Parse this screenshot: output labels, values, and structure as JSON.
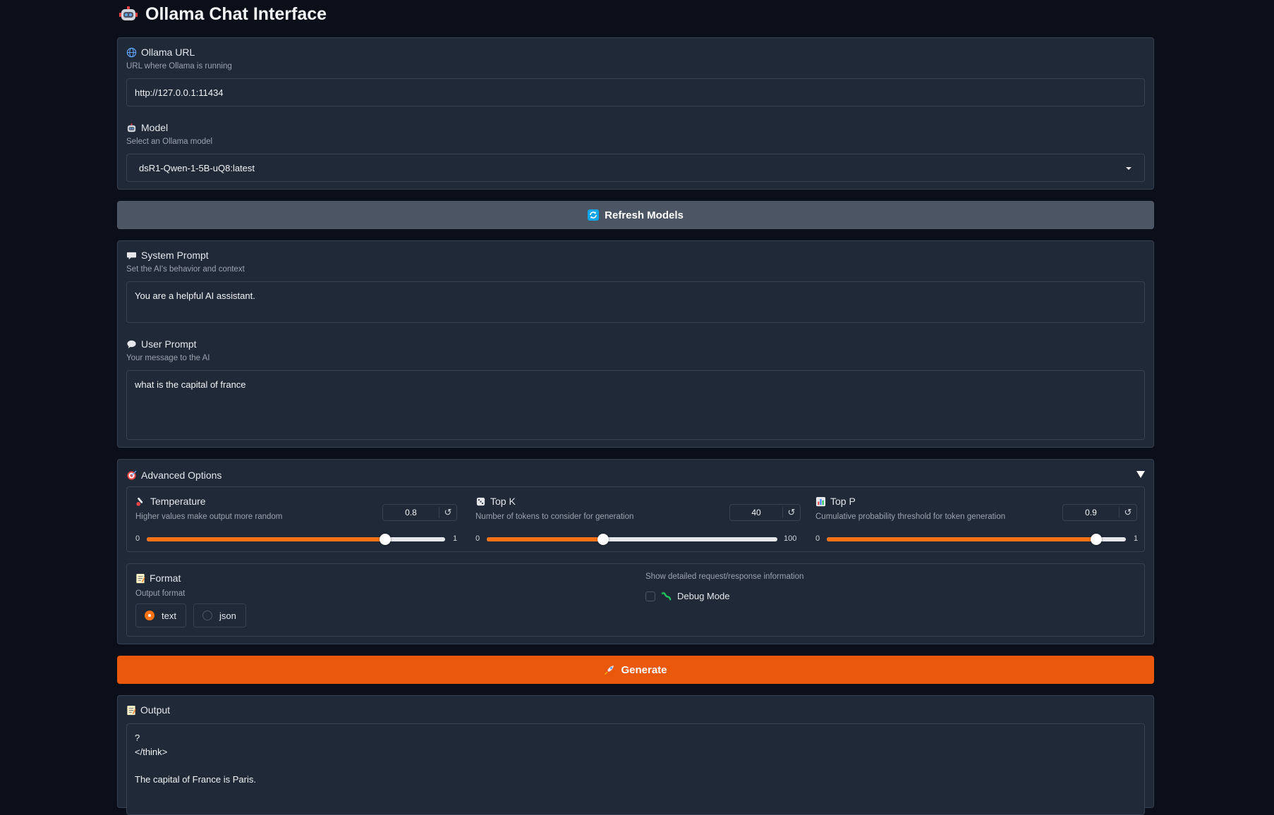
{
  "app": {
    "title": "Ollama Chat Interface"
  },
  "ollama_url": {
    "label": "Ollama URL",
    "info": "URL where Ollama is running",
    "value": "http://127.0.0.1:11434"
  },
  "model": {
    "label": "Model",
    "info": "Select an Ollama model",
    "value": "dsR1-Qwen-1-5B-uQ8:latest"
  },
  "refresh_button": {
    "label": "Refresh Models"
  },
  "system_prompt": {
    "label": "System Prompt",
    "info": "Set the AI's behavior and context",
    "value": "You are a helpful AI assistant."
  },
  "user_prompt": {
    "label": "User Prompt",
    "info": "Your message to the AI",
    "value": "what is the capital of france"
  },
  "advanced": {
    "label": "Advanced Options",
    "temperature": {
      "label": "Temperature",
      "info": "Higher values make output more random",
      "value": "0.8",
      "min": "0",
      "max": "1",
      "fraction": 0.8
    },
    "top_k": {
      "label": "Top K",
      "info": "Number of tokens to consider for generation",
      "value": "40",
      "min": "0",
      "max": "100",
      "fraction": 0.4
    },
    "top_p": {
      "label": "Top P",
      "info": "Cumulative probability threshold for token generation",
      "value": "0.9",
      "min": "0",
      "max": "1",
      "fraction": 0.9
    },
    "reset_glyph": "↺",
    "format": {
      "label": "Format",
      "info": "Output format",
      "options": [
        "text",
        "json"
      ],
      "selected": "text"
    },
    "debug": {
      "info": "Show detailed request/response information",
      "label": "Debug Mode",
      "checked": false
    }
  },
  "generate_button": {
    "label": "Generate"
  },
  "output": {
    "label": "Output",
    "lines": [
      "?",
      "</think>",
      "",
      "The capital of France is Paris."
    ]
  },
  "colors": {
    "accent": "#ea580c",
    "background": "#0b0f19",
    "panel": "#1f2937",
    "border": "#374151"
  },
  "icons": {
    "title": "robot-icon",
    "url": "globe-icon",
    "model": "robot-icon",
    "refresh": "refresh-icon",
    "system": "speech-bubble-icon",
    "user": "chat-bubble-icon",
    "advanced": "target-icon",
    "temperature": "thermometer-icon",
    "top_k": "dice-icon",
    "top_p": "bar-chart-icon",
    "format": "memo-icon",
    "debug": "bug-icon",
    "generate": "rocket-icon",
    "output": "memo-icon",
    "dropdown": "chevron-down-icon",
    "collapse": "triangle-down-icon"
  }
}
